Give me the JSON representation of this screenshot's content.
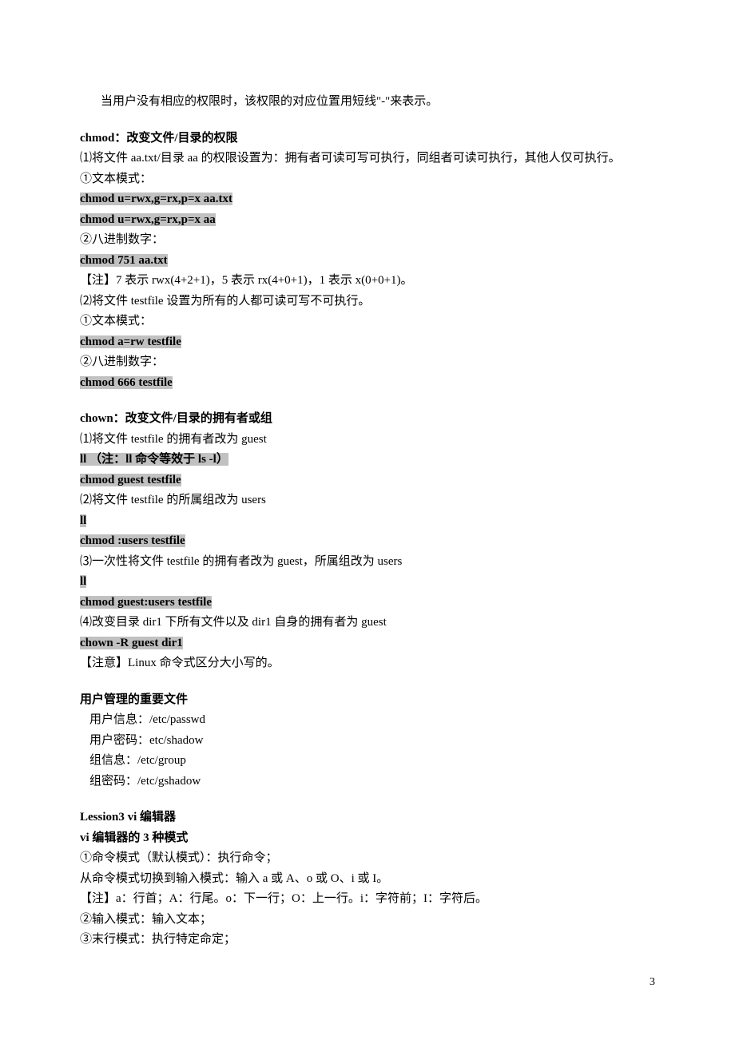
{
  "intro": "当用户没有相应的权限时，该权限的对应位置用短线\"-\"来表示。",
  "chmod": {
    "title": "chmod：改变文件/目录的权限",
    "l1": "⑴将文件 aa.txt/目录 aa 的权限设置为：拥有者可读可写可执行，同组者可读可执行，其他人仅可执行。",
    "l2": "①文本模式：",
    "c1": "chmod u=rwx,g=rx,p=x aa.txt",
    "c2": "chmod u=rwx,g=rx,p=x aa",
    "l3": "②八进制数字：",
    "c3": "chmod 751 aa.txt",
    "l4": "【注】7 表示 rwx(4+2+1)，5 表示 rx(4+0+1)，1 表示 x(0+0+1)。",
    "l5": "⑵将文件 testfile 设置为所有的人都可读可写不可执行。",
    "l6": "①文本模式：",
    "c4": "chmod a=rw testfile",
    "l7": "②八进制数字：",
    "c5": "chmod 666 testfile"
  },
  "chown": {
    "title": "chown：改变文件/目录的拥有者或组",
    "l1": "⑴将文件 testfile 的拥有者改为 guest",
    "c1": "ll        （注：ll 命令等效于 ls -l）",
    "c2": "chmod guest testfile",
    "l2": "⑵将文件 testfile 的所属组改为 users",
    "c3": "ll",
    "c4": "chmod :users testfile",
    "l3": "⑶一次性将文件 testfile 的拥有者改为 guest，所属组改为 users",
    "c5": "ll",
    "c6": "chmod guest:users testfile",
    "l4": "⑷改变目录 dir1 下所有文件以及 dir1 自身的拥有者为 guest",
    "c7": "chown -R guest dir1",
    "l5": "【注意】Linux 命令式区分大小写的。"
  },
  "files": {
    "title": "用户管理的重要文件",
    "l1": "用户信息：/etc/passwd",
    "l2": "用户密码：etc/shadow",
    "l3": "组信息：/etc/group",
    "l4": "组密码：/etc/gshadow"
  },
  "vi": {
    "title1": "Lession3 vi 编辑器",
    "title2": "vi 编辑器的 3 种模式",
    "l1": "①命令模式（默认模式）：执行命令；",
    "l2": "从命令模式切换到输入模式：输入 a 或 A、o 或 O、i 或 I。",
    "l3": "【注】a：行首；A：行尾。o：下一行；O：上一行。i：字符前；I：字符后。",
    "l4": "②输入模式：输入文本；",
    "l5": "③末行模式：执行特定命定；"
  },
  "page": "3"
}
